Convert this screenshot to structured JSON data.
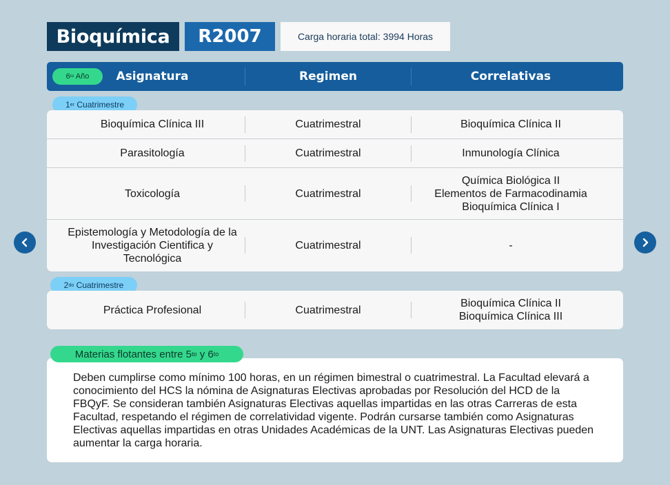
{
  "header": {
    "career": "Bioquímica",
    "plan_code": "R2007",
    "total_hours": "Carga horaria total: 3994 Horas"
  },
  "table_header": {
    "year_base": "6",
    "year_sup": "to",
    "year_suffix": " Año",
    "col_subject": "Asignatura",
    "col_regime": "Regimen",
    "col_correlatives": "Correlativas"
  },
  "semester1": {
    "label_base": "1",
    "label_sup": "er",
    "label_suffix": " Cuatrimestre",
    "rows": [
      {
        "subject": "Bioquímica Clínica III",
        "regime": "Cuatrimestral",
        "correlatives": "Bioquímica Clínica II"
      },
      {
        "subject": "Parasitología",
        "regime": "Cuatrimestral",
        "correlatives": "Inmunología Clínica"
      },
      {
        "subject": "Toxicología",
        "regime": "Cuatrimestral",
        "correlatives": "Química Biológica II\nElementos de Farmacodinamia\nBioquímica Clínica I"
      },
      {
        "subject": "Epistemología y Metodología de la\nInvestigación Cientifica y\nTecnológica",
        "regime": "Cuatrimestral",
        "correlatives": "-"
      }
    ]
  },
  "semester2": {
    "label_base": "2",
    "label_sup": "do",
    "label_suffix": " Cuatrimestre",
    "rows": [
      {
        "subject": "Práctica Profesional",
        "regime": "Cuatrimestral",
        "correlatives": "Bioquímica Clínica II\nBioquímica Clínica III"
      }
    ]
  },
  "floating": {
    "label_prefix": "Materias flotantes entre 5",
    "sup1": "to",
    "label_mid": " y 6",
    "sup2": "to",
    "description": "Deben cumplirse como mínimo 100 horas, en un régimen bimestral o cuatrimestral. La Facultad elevará a conocimiento del HCS la nómina de Asignaturas Electivas aprobadas por Resolución del HCD de la FBQyF. Se consideran también Asignaturas Electivas aquellas impartidas en las otras Carreras de esta Facultad, respetando el régimen de correlatividad vigente. Podrán cursarse también como Asignaturas Electivas aquellas impartidas en otras Unidades Académicas de la UNT. Las Asignaturas Electivas pueden aumentar la carga horaria."
  },
  "navigation": {
    "prev_icon": "chevron-left-icon",
    "next_icon": "chevron-right-icon"
  },
  "colors": {
    "page_bg": "#c0d2db",
    "dark_navy": "#0e3b5c",
    "accent_blue": "#1c68ad",
    "header_blue": "#155d9c",
    "green_pill": "#34d88d",
    "light_blue_pill": "#7ccff7"
  }
}
